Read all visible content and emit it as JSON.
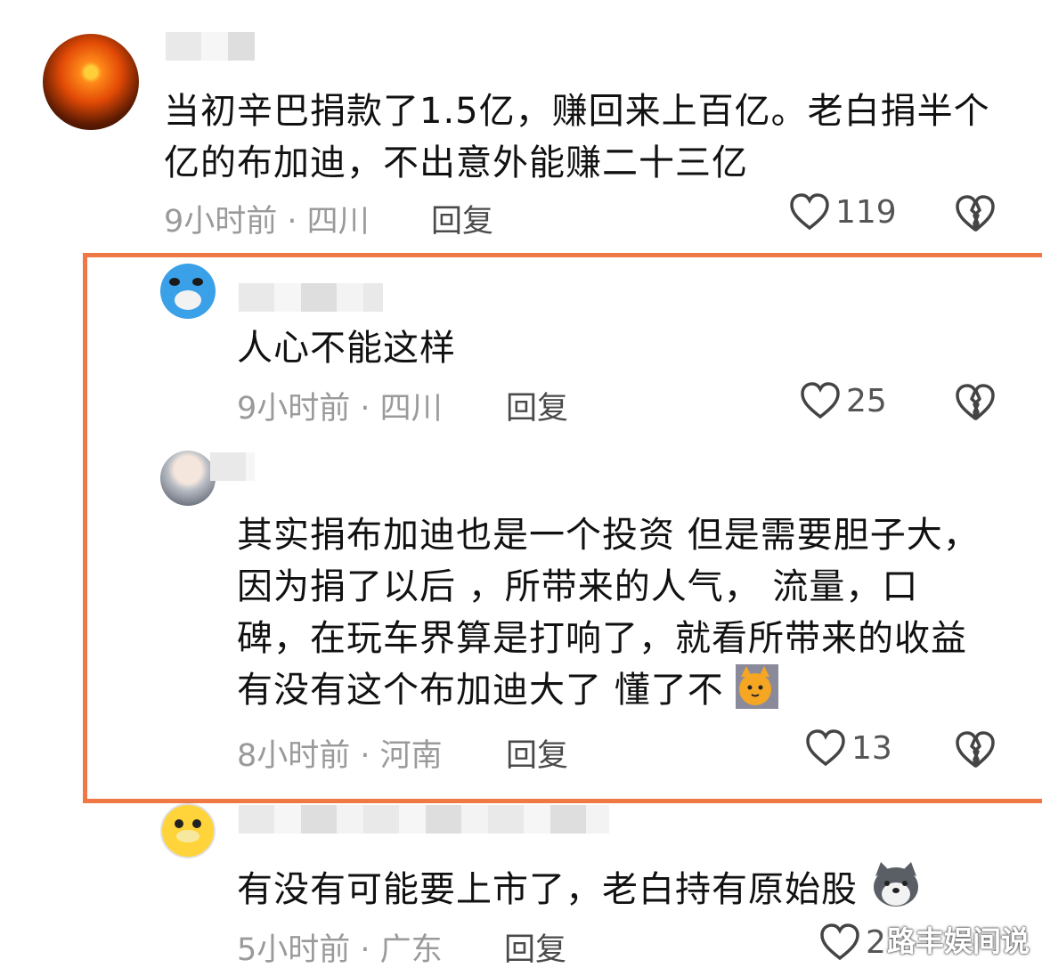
{
  "comments": [
    {
      "text": "当初辛巴捐款了1.5亿，赚回来上百亿。老白捐半个亿的布加迪，不出意外能赚二十三亿",
      "meta": "9小时前 · 四川",
      "reply": "回复",
      "likes": "119"
    },
    {
      "text": "人心不能这样",
      "meta": "9小时前 · 四川",
      "reply": "回复",
      "likes": "25"
    },
    {
      "text": "其实捐布加迪也是一个投资 但是需要胆子大，因为捐了以后 ，所带来的人气， 流量，口碑，在玩车界算是打响了，就看所带来的收益有没有这个布加迪大了 懂了不",
      "meta": "8小时前 · 河南",
      "reply": "回复",
      "likes": "13"
    },
    {
      "text": "有没有可能要上市了，老白持有原始股",
      "meta": "5小时前 · 广东",
      "reply": "回复",
      "likes": "2"
    }
  ],
  "watermark": "路丰娱间说",
  "colors": {
    "highlight": "#f07844",
    "meta": "#9a9a9a"
  }
}
